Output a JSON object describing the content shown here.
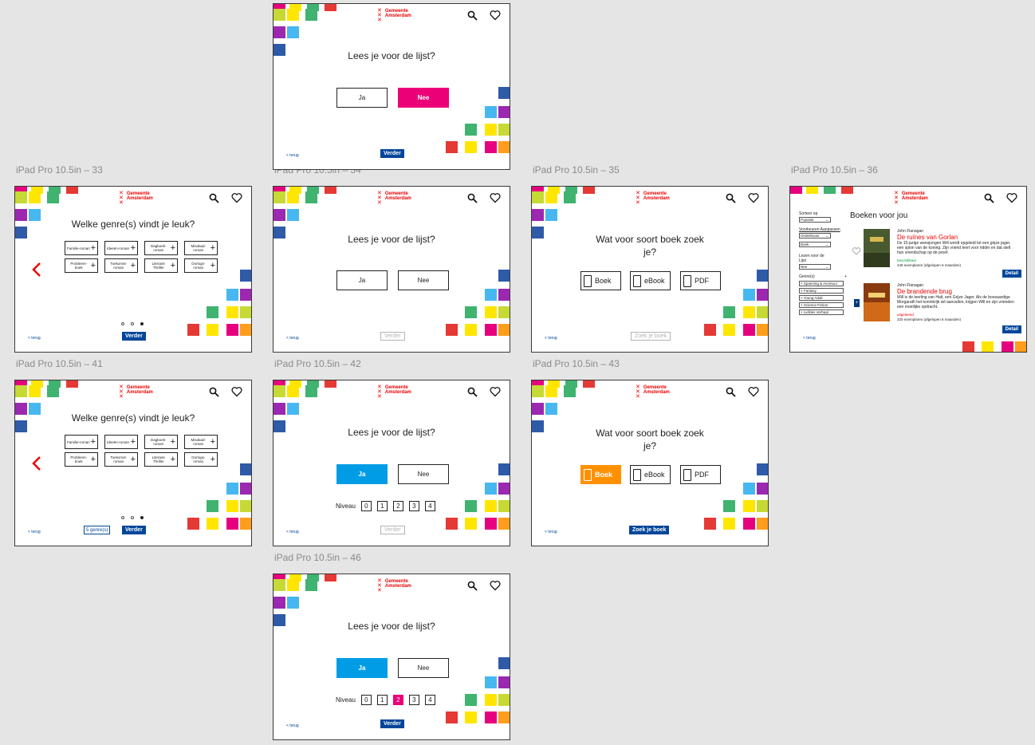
{
  "common": {
    "logo_line1": "Gemeente",
    "logo_line2": "Amsterdam",
    "terug": "< terug",
    "verder": "Verder",
    "zoek_je_boek": "Zoek je boek"
  },
  "labels": {
    "b33": "iPad Pro 10.5in – 33",
    "b34": "iPad Pro 10.5in – 34",
    "b35": "iPad Pro 10.5in – 35",
    "b36": "iPad Pro 10.5in – 36",
    "b41": "iPad Pro 10.5in – 41",
    "b42": "iPad Pro 10.5in – 42",
    "b43": "iPad Pro 10.5in – 43",
    "b46": "iPad Pro 10.5in – 46"
  },
  "q_lijst": "Lees je voor de lijst?",
  "q_genre": "Welke genre(s) vindt je leuk?",
  "q_soort": "Wat voor soort boek zoek je?",
  "ja": "Ja",
  "nee": "Nee",
  "niveau": "Niveau",
  "levels": [
    "0",
    "1",
    "2",
    "3",
    "4"
  ],
  "genres": [
    "Familie-roman",
    "Ideeën-roman",
    "Dagboek-roman",
    "Misdaad-roman",
    "Probleem-boek",
    "Toekomst-roman",
    "Literaire Thriller",
    "Oorlogs-roman"
  ],
  "types": {
    "boek": "Boek",
    "ebook": "eBook",
    "pdf": "PDF"
  },
  "genre_count": "5 genre(s)",
  "results": {
    "sorteer_label": "Sorteer op",
    "sorteer_value": "Populair",
    "voorkeuren_label": "Voorkeuren Aanpassen",
    "leeftijd_value": "Onderbouw",
    "soort_value": "Boek",
    "lijst_label": "Lezen voor de Lijst",
    "lijst_value": "Nee",
    "genres_label": "Genre(s)",
    "chips": [
      "× Spanning & Avontuur",
      "× Fantasy",
      "× Young Adult",
      "× Science Fiction",
      "× Liefdes Verhaal"
    ],
    "title": "Boeken voor jou",
    "detail": "Detail",
    "books": [
      {
        "author": "John Flanagan",
        "title": "De ruïnes van Gorlan",
        "desc": "De 15-jarige weesjongen Will wordt opgeleid tot een grijze jager, een spion van de koning. Zijn vriend leert voor ridder en dat stelt hun vriendschap op de proef.",
        "status": "beschikbaar",
        "count": "249 exemplaren (afgelopen 6 maanden)"
      },
      {
        "author": "John Flanagan",
        "title": "De brandende brug",
        "desc": "Will is de leerling van Halt, een Grijze Jager. Als de boosaardige Morgarath het koninkrijk wil aanvallen, krijgen Will en zijn vrienden een moeilijke opdracht.",
        "status": "uitgeleend",
        "count": "220 exemplaren (afgelopen 6 maanden)"
      }
    ]
  }
}
